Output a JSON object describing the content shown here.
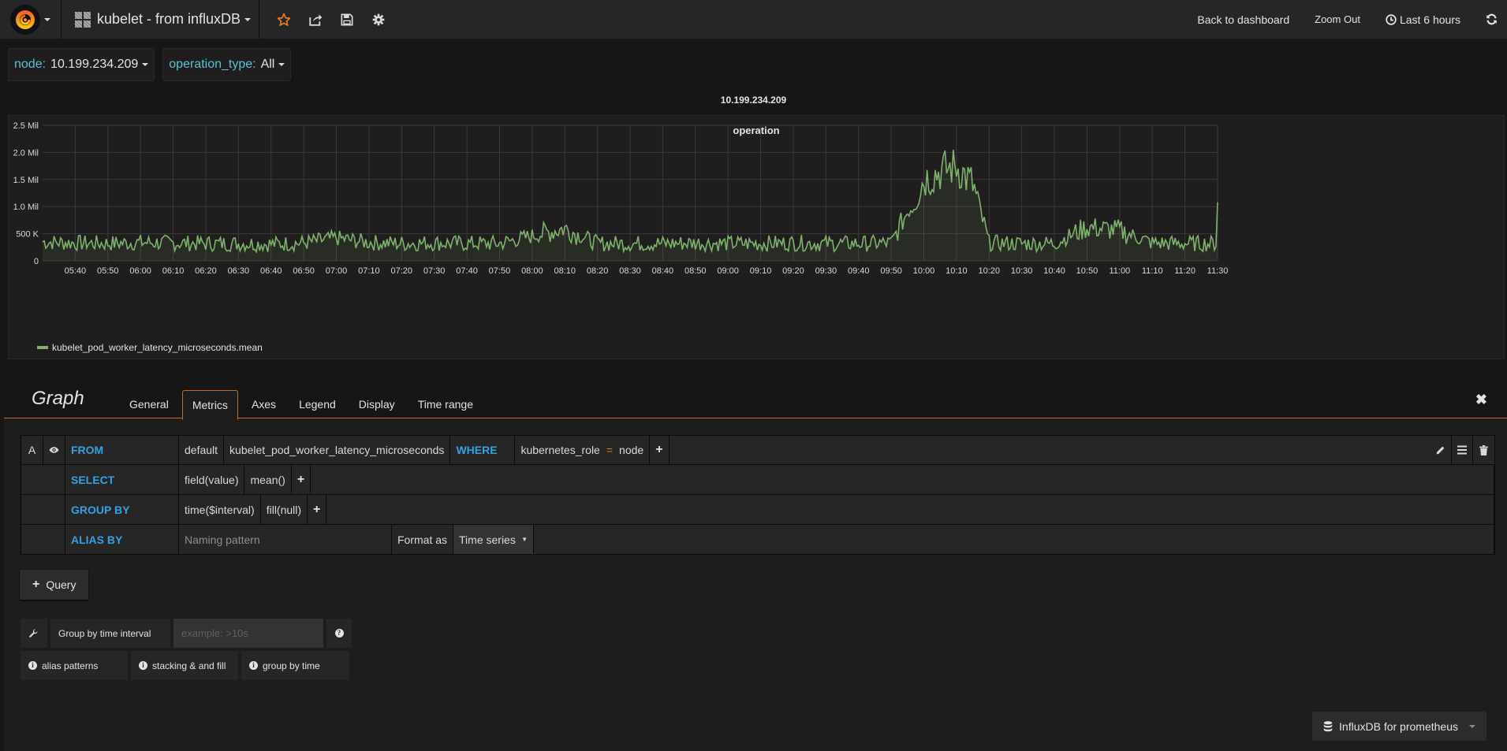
{
  "nav": {
    "dashboard_title": "kubelet - from influxDB",
    "back_to_dashboard": "Back to dashboard",
    "zoom_out": "Zoom Out",
    "time_range": "Last 6 hours",
    "icons": [
      "grafana-logo-icon",
      "star-icon",
      "share-icon",
      "save-icon",
      "settings-icon",
      "clock-icon",
      "refresh-icon"
    ]
  },
  "variables": [
    {
      "label": "node:",
      "value": "10.199.234.209"
    },
    {
      "label": "operation_type:",
      "value": "All"
    }
  ],
  "row_title": "10.199.234.209",
  "panel": {
    "title": "operation",
    "legend": "kubelet_pod_worker_latency_microseconds.mean"
  },
  "chart_data": {
    "type": "area",
    "title": "operation",
    "xlabel": "",
    "ylabel": "",
    "x_range": [
      "05:30",
      "11:30"
    ],
    "ylim": [
      0,
      2500000
    ],
    "y_ticks": [
      "0",
      "500 K",
      "1.0 Mil",
      "1.5 Mil",
      "2.0 Mil",
      "2.5 Mil"
    ],
    "y_tick_values": [
      0,
      500000,
      1000000,
      1500000,
      2000000,
      2500000
    ],
    "x_ticks": [
      "05:40",
      "05:50",
      "06:00",
      "06:10",
      "06:20",
      "06:30",
      "06:40",
      "06:50",
      "07:00",
      "07:10",
      "07:20",
      "07:30",
      "07:40",
      "07:50",
      "08:00",
      "08:10",
      "08:20",
      "08:30",
      "08:40",
      "08:50",
      "09:00",
      "09:10",
      "09:20",
      "09:30",
      "09:40",
      "09:50",
      "10:00",
      "10:10",
      "10:20",
      "10:30",
      "10:40",
      "10:50",
      "11:00",
      "11:10",
      "11:20",
      "11:30"
    ],
    "grid": true,
    "legend_position": "bottom-left",
    "series": [
      {
        "name": "kubelet_pod_worker_latency_microseconds.mean",
        "color": "#7eb26d",
        "profile_minutes_since_0530": [
          0,
          10,
          20,
          30,
          40,
          50,
          60,
          70,
          80,
          90,
          100,
          110,
          120,
          130,
          140,
          150,
          160,
          170,
          180,
          190,
          200,
          210,
          220,
          230,
          240,
          250,
          260,
          270,
          275,
          280,
          285,
          290,
          300,
          310,
          320,
          330,
          340,
          350,
          360
        ],
        "profile_baseline": [
          350000,
          330000,
          320000,
          340000,
          330000,
          320000,
          320000,
          310000,
          330000,
          420000,
          340000,
          320000,
          330000,
          320000,
          320000,
          460000,
          600000,
          320000,
          320000,
          320000,
          330000,
          320000,
          320000,
          330000,
          320000,
          320000,
          330000,
          1500000,
          1650000,
          1750000,
          1400000,
          330000,
          320000,
          320000,
          620000,
          560000,
          330000,
          320000,
          320000
        ],
        "noise_amplitude": 150000,
        "last_value": 1080000
      }
    ]
  },
  "editor": {
    "title": "Graph",
    "tabs": [
      "General",
      "Metrics",
      "Axes",
      "Legend",
      "Display",
      "Time range"
    ],
    "active_tab": "Metrics",
    "query": {
      "ref": "A",
      "from_kw": "FROM",
      "policy": "default",
      "measurement": "kubelet_pod_worker_latency_microseconds",
      "where_kw": "WHERE",
      "where_key": "kubernetes_role",
      "where_op": "=",
      "where_value": "node",
      "select_kw": "SELECT",
      "select_field": "field(value)",
      "select_fn": "mean()",
      "group_kw": "GROUP BY",
      "group_time": "time($interval)",
      "group_fill": "fill(null)",
      "alias_kw": "ALIAS BY",
      "alias_placeholder": "Naming pattern",
      "format_label": "Format as",
      "format_value": "Time series"
    },
    "add_query": "Query",
    "group_interval_label": "Group by time interval",
    "group_interval_placeholder": "example: >10s",
    "help_buttons": [
      "alias patterns",
      "stacking & and fill",
      "group by time"
    ],
    "datasource": "InfluxDB for prometheus"
  }
}
